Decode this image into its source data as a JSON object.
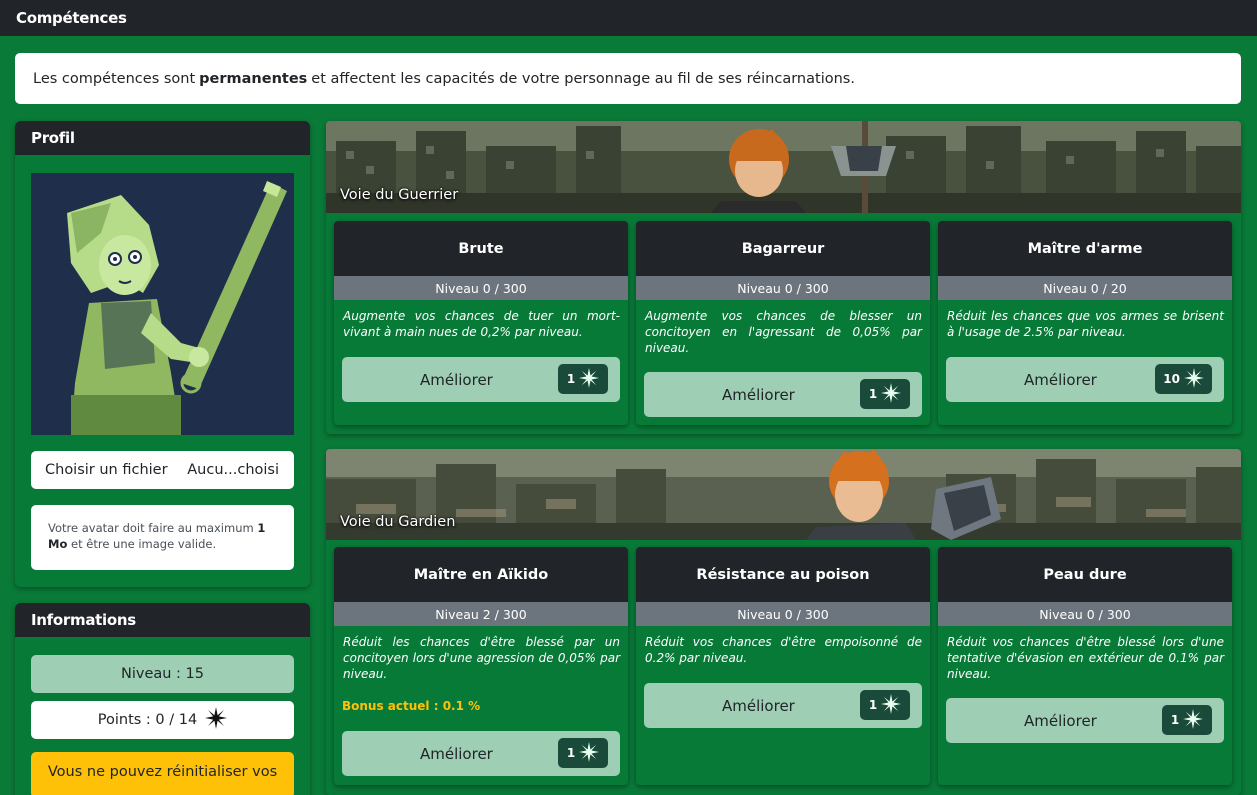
{
  "page": {
    "title": "Compétences"
  },
  "intro": {
    "prefix": "Les compétences sont",
    "bold": "permanentes",
    "suffix": "et affectent les capacités de votre personnage au fil de ses réincarnations."
  },
  "profile": {
    "title": "Profil",
    "file_button": "Choisir un fichier",
    "file_status": "Aucu...choisi",
    "help_prefix": "Votre avatar doit faire au maximum",
    "help_bold_1": "1",
    "help_bold_2": "Mo",
    "help_suffix": "et être une image valide."
  },
  "info": {
    "title": "Informations",
    "level": "Niveau : 15",
    "points": "Points : 0 / 14",
    "reset": "Vous ne pouvez réinitialiser vos"
  },
  "ways": [
    {
      "title": "Voie du Guerrier",
      "skills": [
        {
          "name": "Brute",
          "level": "Niveau 0 / 300",
          "desc": "Augmente vos chances de tuer un mort-vivant à main nues de 0,2% par niveau.",
          "button": "Améliorer",
          "cost": "1"
        },
        {
          "name": "Bagarreur",
          "level": "Niveau 0 / 300",
          "desc": "Augmente vos chances de blesser un concitoyen en l'agressant de 0,05% par niveau.",
          "button": "Améliorer",
          "cost": "1"
        },
        {
          "name": "Maître d'arme",
          "level": "Niveau 0 / 20",
          "desc": "Réduit les chances que vos armes se brisent à l'usage de 2.5% par niveau.",
          "button": "Améliorer",
          "cost": "10"
        }
      ]
    },
    {
      "title": "Voie du Gardien",
      "skills": [
        {
          "name": "Maître en Aïkido",
          "level": "Niveau 2 / 300",
          "desc": "Réduit les chances d'être blessé par un concitoyen lors d'une agression de 0,05% par niveau.",
          "bonus": "Bonus actuel : 0.1 %",
          "button": "Améliorer",
          "cost": "1"
        },
        {
          "name": "Résistance au poison",
          "level": "Niveau 0 / 300",
          "desc": "Réduit vos chances d'être empoisonné de 0.2% par niveau.",
          "button": "Améliorer",
          "cost": "1"
        },
        {
          "name": "Peau dure",
          "level": "Niveau 0 / 300",
          "desc": "Réduit vos chances d'être blessé lors d'une tentative d'évasion en extérieur de 0.1% par niveau.",
          "button": "Améliorer",
          "cost": "1"
        }
      ]
    }
  ],
  "icons": {
    "points": "star-burst-icon",
    "cost": "star-burst-icon",
    "avatar": "pixel-art-avatar",
    "banner": "ruined-city-banner"
  },
  "colors": {
    "background": "#0a7a38",
    "header": "#212428",
    "button": "#9ecfb4",
    "warning": "#ffc107",
    "level_bar": "#6c757d"
  }
}
